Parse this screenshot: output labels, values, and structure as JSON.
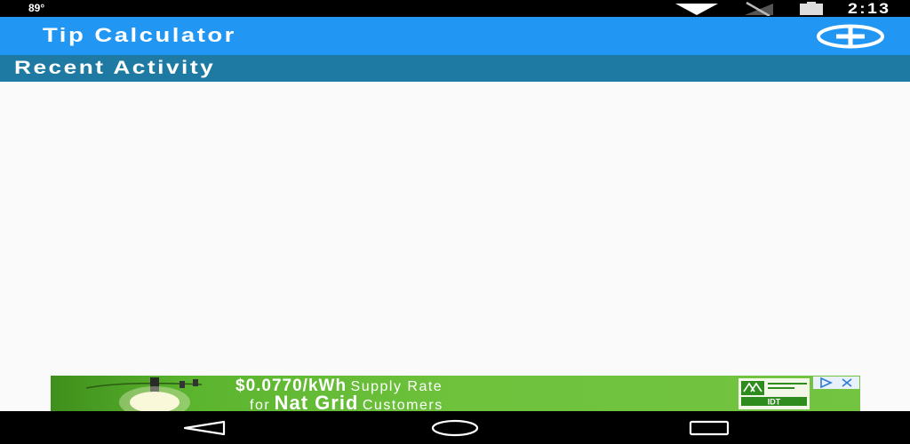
{
  "status_bar": {
    "temperature": "89°",
    "time": "2:13",
    "icons": [
      "wifi-icon",
      "no-signal-icon",
      "battery-icon"
    ]
  },
  "app_bar": {
    "title": "Tip Calculator",
    "add_icon": "plus-circle-icon"
  },
  "section": {
    "title": "Recent Activity",
    "items": []
  },
  "ad": {
    "price": "$0.0770/kWh",
    "line1_suffix": "Supply Rate",
    "for": "for",
    "brand": "Nat Grid",
    "customers": "Customers",
    "logo_text": "IDT",
    "choices_icons": [
      "ad-choices-icon",
      "close-ad-icon"
    ]
  },
  "nav_bar": {
    "buttons": [
      "back-icon",
      "home-icon",
      "recents-icon"
    ]
  },
  "colors": {
    "status_bar": "#000000",
    "app_bar": "#2196f3",
    "section_header": "#1e7aa3",
    "background": "#fafafa",
    "ad_green": "#6ec23c",
    "nav_bar": "#000000"
  }
}
